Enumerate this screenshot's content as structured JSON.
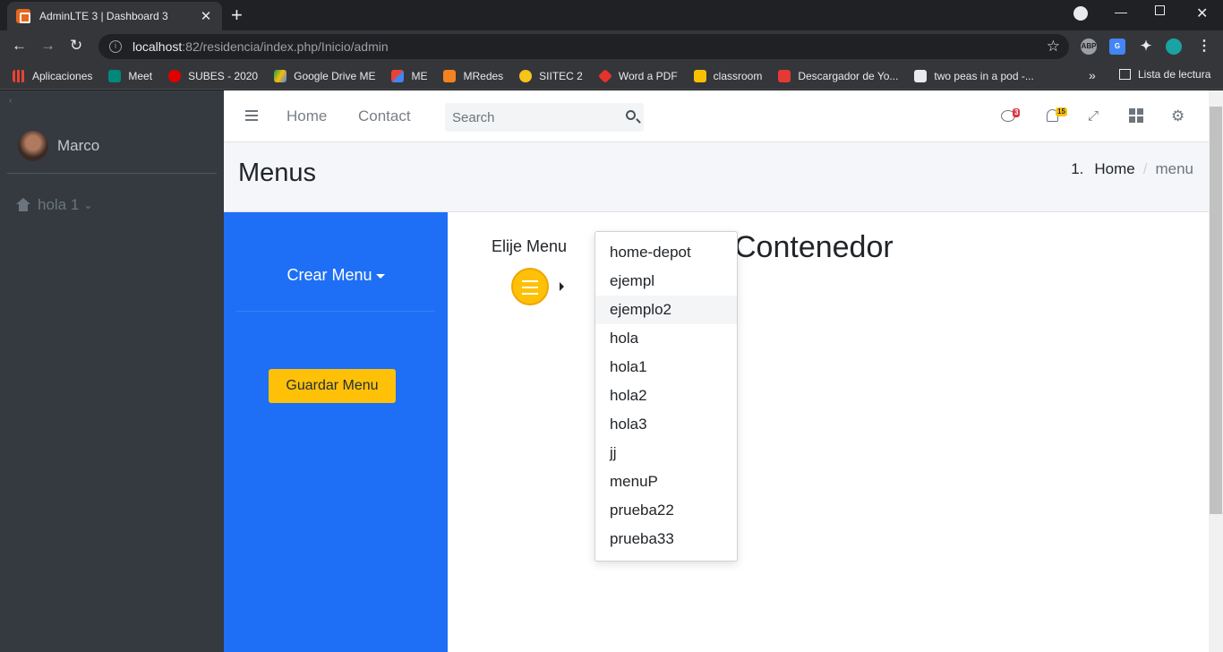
{
  "browser": {
    "tab_title": "AdminLTE 3 | Dashboard 3",
    "tab_close": "✕",
    "new_tab": "+",
    "url_host": "localhost",
    "url_path": ":82/residencia/index.php/Inicio/admin",
    "bookmarks": [
      "Aplicaciones",
      "Meet",
      "SUBES - 2020",
      "Google Drive ME",
      "ME",
      "MRedes",
      "SIITEC 2",
      "Word a PDF",
      "classroom",
      "Descargador de Yo...",
      "two peas in a pod -..."
    ],
    "bookmark_more": "»",
    "reading_list": "Lista de lectura"
  },
  "sidebar": {
    "user_name": "Marco",
    "nav_item": "hola 1"
  },
  "topnav": {
    "home": "Home",
    "contact": "Contact",
    "search_placeholder": "Search",
    "messages_count": "3",
    "notifications_count": "15"
  },
  "header": {
    "title": "Menus",
    "breadcrumb_index": "1.",
    "breadcrumb_home": "Home",
    "breadcrumb_sep": "/",
    "breadcrumb_current": "menu"
  },
  "panel": {
    "crear_menu": "Crear Menu",
    "guardar_menu": "Guardar Menu"
  },
  "main": {
    "elije_menu": "Elije Menu",
    "contenedor": "Contenedor"
  },
  "dropdown": {
    "items": [
      "home-depot",
      "ejempl",
      "ejemplo2",
      "hola",
      "hola1",
      "hola2",
      "hola3",
      "jj",
      "menuP",
      "prueba22",
      "prueba33"
    ],
    "hovered": "ejemplo2"
  },
  "colors": {
    "accent_blue": "#1e6ff5",
    "warning_yellow": "#ffc107",
    "sidebar_dark": "#343a40"
  }
}
